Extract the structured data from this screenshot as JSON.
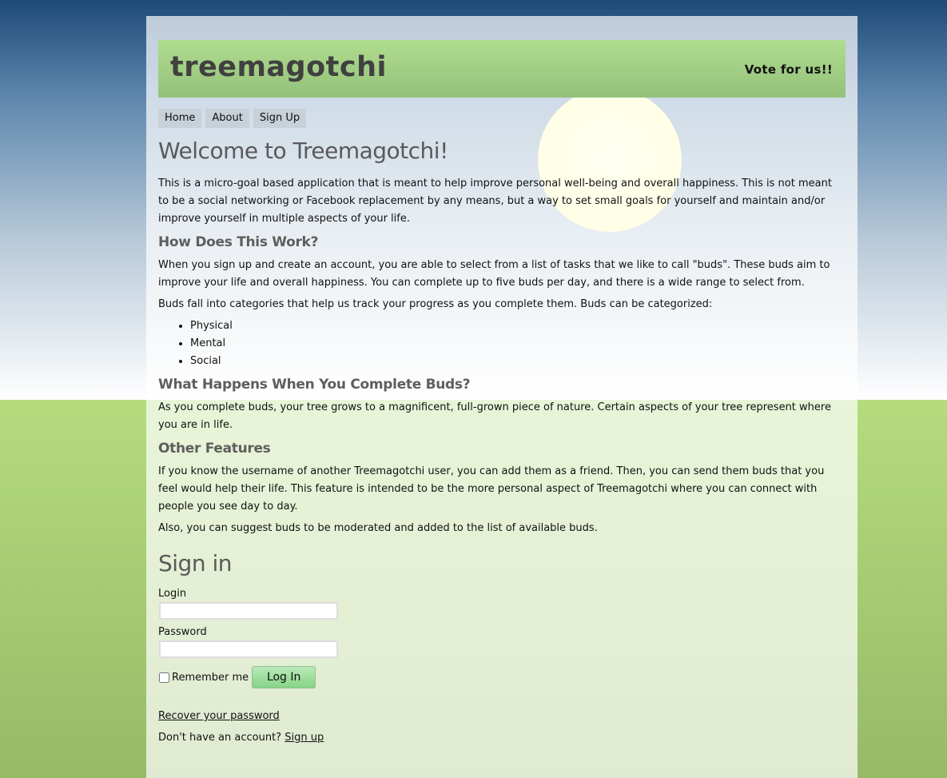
{
  "header": {
    "logo": "treemagotchi",
    "vote_link": "Vote for us!!"
  },
  "nav": {
    "items": [
      "Home",
      "About",
      "Sign Up"
    ]
  },
  "content": {
    "welcome_title": "Welcome to Treemagotchi!",
    "intro": "This is a micro-goal based application that is meant to help improve personal well-being and overall happiness. This is not meant to be a social networking or Facebook replacement by any means, but a way to set small goals for yourself and maintain and/or improve yourself in multiple aspects of your life.",
    "how_title": "How Does This Work?",
    "how_p1": "When you sign up and create an account, you are able to select from a list of tasks that we like to call \"buds\". These buds aim to improve your life and overall happiness. You can complete up to five buds per day, and there is a wide range to select from.",
    "how_p2": "Buds fall into categories that help us track your progress as you complete them. Buds can be categorized:",
    "categories": [
      "Physical",
      "Mental",
      "Social"
    ],
    "happens_title": "What Happens When You Complete Buds?",
    "happens_p": "As you complete buds, your tree grows to a magnificent, full-grown piece of nature. Certain aspects of your tree represent where you are in life.",
    "other_title": "Other Features",
    "other_p1": "If you know the username of another Treemagotchi user, you can add them as a friend. Then, you can send them buds that you feel would help their life. This feature is intended to be the more personal aspect of Treemagotchi where you can connect with people you see day to day.",
    "other_p2": "Also, you can suggest buds to be moderated and added to the list of available buds."
  },
  "signin": {
    "title": "Sign in",
    "login_label": "Login",
    "login_value": "",
    "password_label": "Password",
    "password_value": "",
    "remember_label": "Remember me",
    "login_button": "Log In",
    "recover_link": "Recover your password",
    "no_account_text": "Don't have an account?",
    "signup_link": "Sign up"
  }
}
